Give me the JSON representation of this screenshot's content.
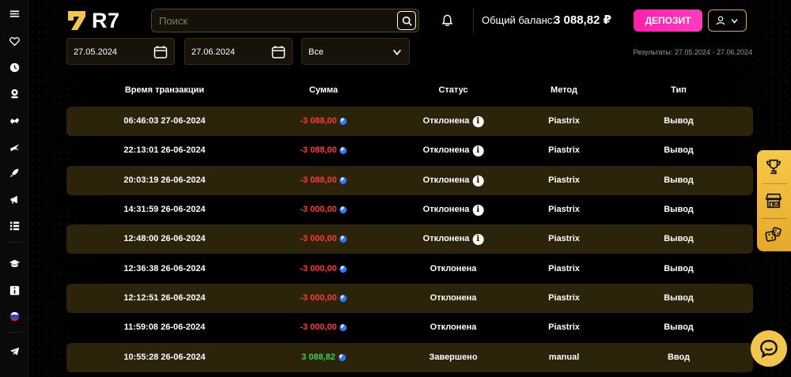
{
  "header": {
    "logo_text": "R7",
    "search_placeholder": "Поиск",
    "balance_label": "Общий баланс:",
    "balance_value": "3 088,82 ₽",
    "deposit_label": "ДЕПОЗИТ"
  },
  "sidebar": {
    "icons": [
      "menu-icon",
      "heart-icon",
      "clock-icon",
      "live-casino-icon",
      "sports-icon",
      "aviator-icon",
      "rocket-icon",
      "megaphone-icon",
      "list-icon",
      "graduation-icon",
      "info-icon",
      "russia-flag-icon",
      "telegram-icon"
    ]
  },
  "filters": {
    "date_from": "27.05.2024",
    "date_to": "27.06.2024",
    "type_select": "Все",
    "results_text": "Результаты: 27.05.2024 - 27.06.2024"
  },
  "table": {
    "headers": [
      "Время транзакции",
      "Сумма",
      "Статус",
      "Метод",
      "Тип"
    ],
    "rows": [
      {
        "time": "06:46:03 27-06-2024",
        "amount": "-3 088,00",
        "sign": "neg",
        "status": "Отклонена",
        "info": true,
        "method": "Piastrix",
        "type": "Вывод"
      },
      {
        "time": "22:13:01 26-06-2024",
        "amount": "-3 088,00",
        "sign": "neg",
        "status": "Отклонена",
        "info": true,
        "method": "Piastrix",
        "type": "Вывод"
      },
      {
        "time": "20:03:19 26-06-2024",
        "amount": "-3 088,00",
        "sign": "neg",
        "status": "Отклонена",
        "info": true,
        "method": "Piastrix",
        "type": "Вывод"
      },
      {
        "time": "14:31:59 26-06-2024",
        "amount": "-3 000,00",
        "sign": "neg",
        "status": "Отклонена",
        "info": true,
        "method": "Piastrix",
        "type": "Вывод"
      },
      {
        "time": "12:48:00 26-06-2024",
        "amount": "-3 000,00",
        "sign": "neg",
        "status": "Отклонена",
        "info": true,
        "method": "Piastrix",
        "type": "Вывод"
      },
      {
        "time": "12:36:38 26-06-2024",
        "amount": "-3 000,00",
        "sign": "neg",
        "status": "Отклонена",
        "info": false,
        "method": "Piastrix",
        "type": "Вывод"
      },
      {
        "time": "12:12:51 26-06-2024",
        "amount": "-3 000,00",
        "sign": "neg",
        "status": "Отклонена",
        "info": false,
        "method": "Piastrix",
        "type": "Вывод"
      },
      {
        "time": "11:59:08 26-06-2024",
        "amount": "-3 000,00",
        "sign": "neg",
        "status": "Отклонена",
        "info": false,
        "method": "Piastrix",
        "type": "Вывод"
      },
      {
        "time": "10:55:28 26-06-2024",
        "amount": "3 088,82",
        "sign": "pos",
        "status": "Завершено",
        "info": false,
        "method": "manual",
        "type": "Ввод"
      }
    ]
  },
  "float_panel": {
    "icons": [
      "trophy-icon",
      "shop-icon",
      "dice-icon"
    ]
  },
  "colors": {
    "accent": "#f2c54d",
    "deposit": "#ff2fb4",
    "negative": "#ff3b3b",
    "positive": "#3bd24a",
    "row_stripe": "#2b230a"
  }
}
